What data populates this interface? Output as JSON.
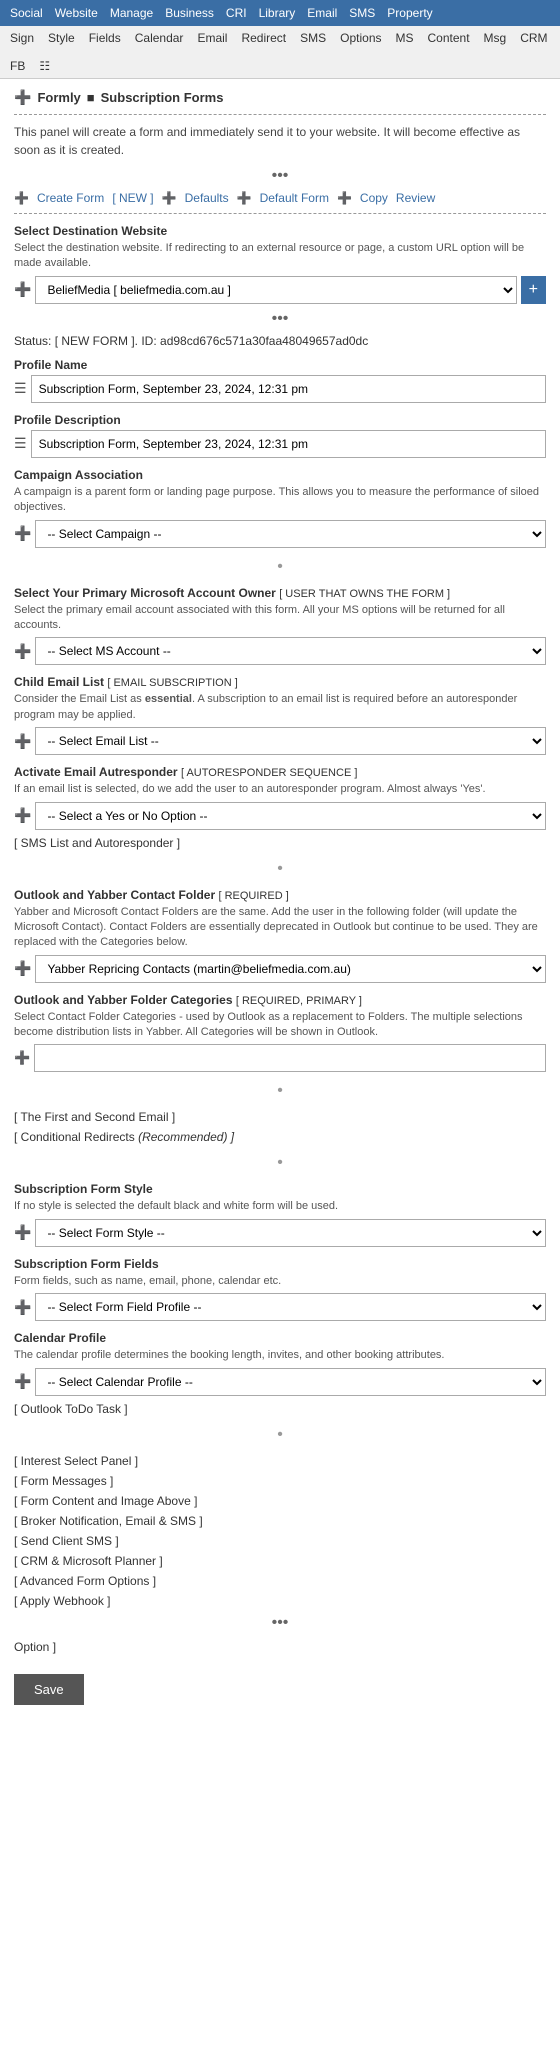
{
  "topnav": {
    "items": [
      "Social",
      "Website",
      "Manage",
      "Business",
      "CRI",
      "Library",
      "Email",
      "SMS",
      "Property"
    ]
  },
  "subnav": {
    "items": [
      "Sign",
      "Style",
      "Fields",
      "Calendar",
      "Email",
      "Redirect",
      "SMS",
      "Options",
      "MS",
      "Content",
      "Msg",
      "CRM",
      "FB"
    ]
  },
  "breadcrumb": {
    "part1": "Formly",
    "part2": "Subscription Forms"
  },
  "intro": {
    "text": "This panel will create a form and immediately send it to your website. It will become effective as soon as it is created."
  },
  "toolbar": {
    "create_label": "Create Form",
    "new_label": "[ NEW ]",
    "defaults_label": "Defaults",
    "default_form_label": "Default Form",
    "copy_label": "Copy",
    "review_label": "Review"
  },
  "destination": {
    "label": "Select Destination Website",
    "desc": "Select the destination website. If redirecting to an external resource or page, a custom URL option will be made available.",
    "value": "BeliefMedia [ beliefmedia.com.au ]"
  },
  "status": {
    "text": "Status: [ NEW FORM ]. ID: ad98cd676c571a30faa48049657ad0dc"
  },
  "profile_name": {
    "label": "Profile Name",
    "value": "Subscription Form, September 23, 2024, 12:31 pm"
  },
  "profile_desc": {
    "label": "Profile Description",
    "value": "Subscription Form, September 23, 2024, 12:31 pm"
  },
  "campaign": {
    "label": "Campaign Association",
    "desc": "A campaign is a parent form or landing page purpose. This allows you to measure the performance of siloed objectives.",
    "placeholder": "-- Select Campaign --"
  },
  "ms_account": {
    "section_label": "Select Your Primary Microsoft Account Owner",
    "section_tag": "[ USER THAT OWNS THE FORM ]",
    "desc": "Select the primary email account associated with this form. All your MS options will be returned for all accounts.",
    "placeholder": "-- Select MS Account --"
  },
  "email_list": {
    "label": "Child Email List",
    "tag": "[ EMAIL SUBSCRIPTION ]",
    "desc": "Consider the Email List as essential. A subscription to an email list is required before an autoresponder program may be applied.",
    "placeholder": "-- Select Email List --"
  },
  "autoresponder": {
    "label": "Activate Email Autresponder",
    "tag": "[ AUTORESPONDER SEQUENCE ]",
    "desc": "If an email list is selected, do we add the user to an autoresponder program. Almost always 'Yes'.",
    "placeholder": "-- Select a Yes or No Option --"
  },
  "sms_link": {
    "text": "[ SMS List and Autoresponder ]"
  },
  "contact_folder": {
    "label": "Outlook and Yabber Contact Folder",
    "tag": "[ REQUIRED ]",
    "desc": "Yabber and Microsoft Contact Folders are the same. Add the user in the following folder (will update the Microsoft Contact). Contact Folders are essentially deprecated in Outlook but continue to be used. They are replaced with the Categories below.",
    "value": "Yabber Repricing Contacts (martin@beliefmedia.com.au)"
  },
  "folder_categories": {
    "label": "Outlook and Yabber Folder Categories",
    "tag": "[ REQUIRED, PRIMARY ]",
    "desc": "Select Contact Folder Categories - used by Outlook as a replacement to Folders. The multiple selections become distribution lists in Yabber. All Categories will be shown in Outlook.",
    "placeholder": ""
  },
  "first_second_email": {
    "text": "[ The First and Second Email ]"
  },
  "conditional_redirects": {
    "text": "[ Conditional Redirects",
    "tag": "(Recommended) ]"
  },
  "form_style": {
    "label": "Subscription Form Style",
    "desc": "If no style is selected the default black and white form will be used.",
    "placeholder": "-- Select Form Style --"
  },
  "form_fields": {
    "label": "Subscription Form Fields",
    "desc": "Form fields, such as name, email, phone, calendar etc.",
    "placeholder": "-- Select Form Field Profile --"
  },
  "calendar_profile": {
    "label": "Calendar Profile",
    "desc": "The calendar profile determines the booking length, invites, and other booking attributes.",
    "placeholder": "-- Select Calendar Profile --"
  },
  "outlook_todo": {
    "text": "[ Outlook ToDo Task ]"
  },
  "extra_links": [
    "[ Interest Select Panel ]",
    "[ Form Messages ]",
    "[ Form Content and Image Above ]",
    "[ Broker Notification, Email & SMS ]",
    "[ Send Client SMS ]",
    "[ CRM & Microsoft Planner ]",
    "[ Advanced Form Options ]",
    "[ Apply Webhook ]"
  ],
  "option_label": "Option ]",
  "save_label": "Save"
}
